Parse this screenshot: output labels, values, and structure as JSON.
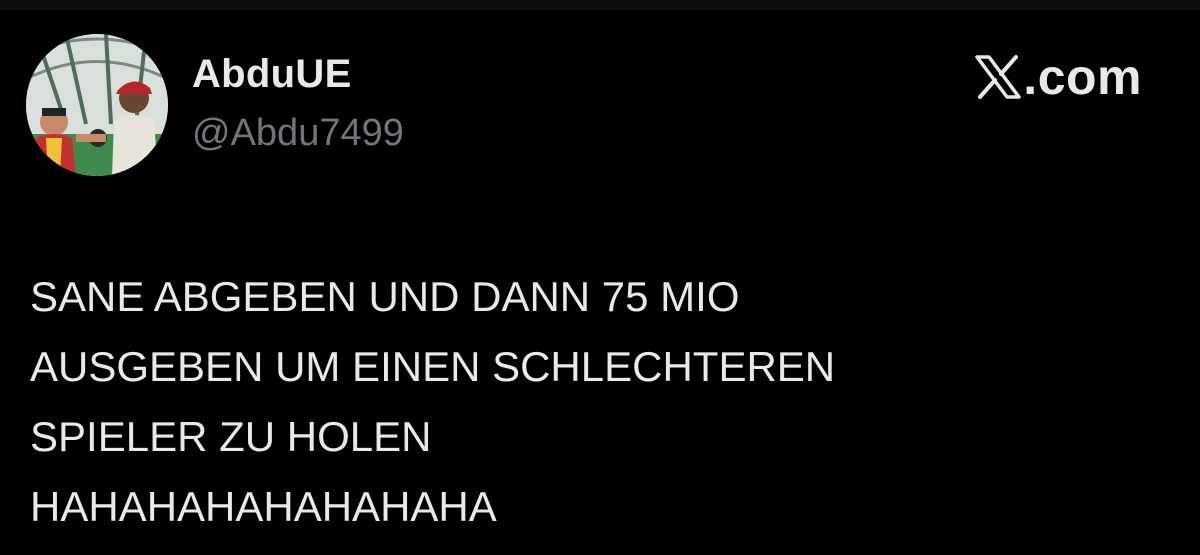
{
  "tweet": {
    "display_name": "AbduUE",
    "handle": "@Abdu7499",
    "text": "SANE ABGEBEN UND DANN 75 MIO\nAUSGEBEN UM EINEN SCHLECHTEREN\nSPIELER ZU HOLEN\nHAHAHAHAHAHAHAHA"
  },
  "brand": {
    "icon": "x-logo-icon",
    "label": ".com"
  },
  "colors": {
    "background": "#000000",
    "primary_text": "#e7e9ea",
    "secondary_text": "#71767b"
  }
}
